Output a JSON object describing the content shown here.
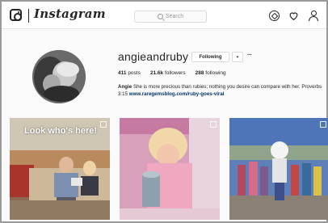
{
  "brand": {
    "wordmark": "Instagram"
  },
  "search": {
    "placeholder": "Search"
  },
  "nav": {
    "icons": [
      "compass-icon",
      "heart-icon",
      "person-icon"
    ]
  },
  "profile": {
    "username": "angieandruby",
    "follow_label": "Following",
    "dropdown_label": "▾",
    "more_label": "···",
    "stats": [
      {
        "value": "411",
        "label": "posts"
      },
      {
        "value": "21.6k",
        "label": "followers"
      },
      {
        "value": "288",
        "label": "following"
      }
    ],
    "bio": {
      "name": "Angie",
      "text": "She is more precious than rubies; nothing you desire can compare with her. Proverbs 3:15",
      "link": "www.raregemsblog.com/ruby-goes-viral"
    }
  },
  "posts": [
    {
      "caption": "Look who's here!",
      "type_icon": "multi-photo-icon"
    },
    {
      "caption": "",
      "type_icon": "multi-photo-icon"
    },
    {
      "caption": "",
      "type_icon": "multi-photo-icon"
    }
  ],
  "colors": {
    "link": "#003569",
    "border": "#dbdbdb",
    "text": "#262626"
  }
}
